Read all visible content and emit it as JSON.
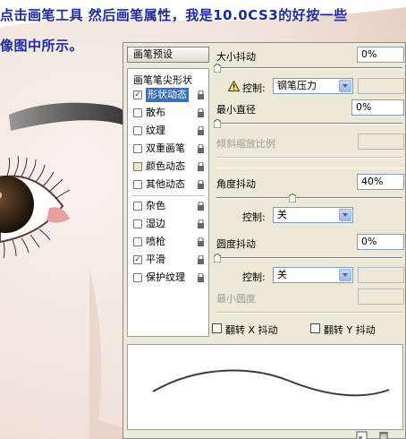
{
  "caption": {
    "line1": "点击画笔工具 然后画笔属性，我是10.0CS3的好按一些",
    "line2": "像图中所示。"
  },
  "panel": {
    "preset_button": "画笔预设",
    "tip_shape": "画笔笔尖形状",
    "options": [
      {
        "label": "形状动态",
        "checked": true,
        "selected": true
      },
      {
        "label": "散布",
        "checked": false
      },
      {
        "label": "纹理",
        "checked": false
      },
      {
        "label": "双重画笔",
        "checked": false
      },
      {
        "label": "颜色动态",
        "checked": false
      },
      {
        "label": "其他动态",
        "checked": false
      },
      {
        "label": "杂色",
        "checked": false
      },
      {
        "label": "湿边",
        "checked": false
      },
      {
        "label": "喷枪",
        "checked": false
      },
      {
        "label": "平滑",
        "checked": true
      },
      {
        "label": "保护纹理",
        "checked": false
      }
    ],
    "size_jitter": {
      "label": "大小抖动",
      "value": "0%"
    },
    "size_control": {
      "label": "控制:",
      "value": "钢笔压力"
    },
    "min_diameter": {
      "label": "最小直径",
      "value": "0%"
    },
    "tilt_scale": {
      "label": "倾斜缩放比例"
    },
    "angle_jitter": {
      "label": "角度抖动",
      "value": "40%"
    },
    "angle_control": {
      "label": "控制:",
      "value": "关"
    },
    "roundness_jitter": {
      "label": "圆度抖动",
      "value": "0%"
    },
    "roundness_control": {
      "label": "控制:",
      "value": "关"
    },
    "min_roundness": {
      "label": "最小圆度"
    },
    "flip_x": {
      "label": "翻转 X 抖动",
      "checked": false
    },
    "flip_y": {
      "label": "翻转 Y 抖动",
      "checked": false
    }
  }
}
